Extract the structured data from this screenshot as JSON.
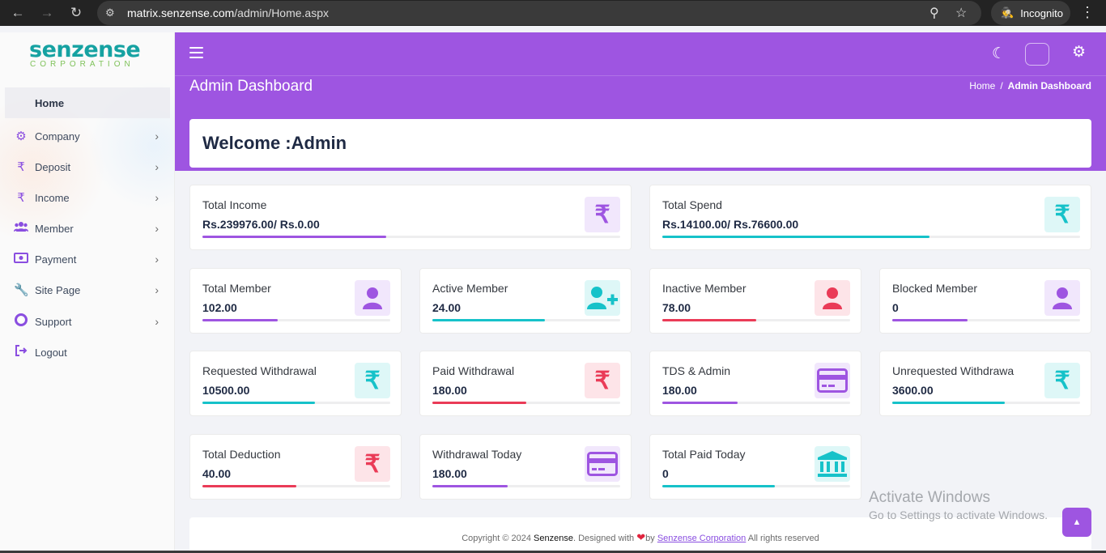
{
  "browser": {
    "url_host": "matrix.senzense.com",
    "url_path": "/admin/Home.aspx",
    "profile_label": "Incognito"
  },
  "brand": {
    "wordmark": "senzense",
    "tagline": "CORPORATION"
  },
  "sidebar": {
    "items": [
      {
        "label": "Home",
        "icon": "home-icon"
      },
      {
        "label": "Company",
        "icon": "gear-icon"
      },
      {
        "label": "Deposit",
        "icon": "rupee-icon"
      },
      {
        "label": "Income",
        "icon": "rupee-icon"
      },
      {
        "label": "Member",
        "icon": "users-icon"
      },
      {
        "label": "Payment",
        "icon": "money-icon"
      },
      {
        "label": "Site Page",
        "icon": "wrench-icon"
      },
      {
        "label": "Support",
        "icon": "lifebuoy-icon"
      },
      {
        "label": "Logout",
        "icon": "logout-icon"
      }
    ]
  },
  "header": {
    "page_title": "Admin Dashboard",
    "breadcrumb": {
      "home": "Home",
      "separator": "/",
      "current": "Admin Dashboard"
    },
    "welcome": "Welcome :Admin"
  },
  "cards": [
    {
      "title": "Total Income",
      "value": "Rs.239976.00/ Rs.0.00",
      "icon": "rupee-icon",
      "progress": 0.44,
      "color": "#9e55e1"
    },
    {
      "title": "Total Spend",
      "value": "Rs.14100.00/ Rs.76600.00",
      "icon": "rupee-icon",
      "progress": 0.64,
      "color": "#16c2c9"
    },
    {
      "title": "Total Member",
      "value": "102.00",
      "icon": "user-icon",
      "progress": 0.4,
      "color": "#9e55e1"
    },
    {
      "title": "Active Member",
      "value": "24.00",
      "icon": "user-plus-icon",
      "progress": 0.6,
      "color": "#16c2c9"
    },
    {
      "title": "Inactive Member",
      "value": "78.00",
      "icon": "user-icon",
      "progress": 0.5,
      "color": "#ea3b57"
    },
    {
      "title": "Blocked Member",
      "value": "0",
      "icon": "user-icon",
      "progress": 0.4,
      "color": "#9e55e1"
    },
    {
      "title": "Requested Withdrawal",
      "value": "10500.00",
      "icon": "rupee-icon",
      "progress": 0.6,
      "color": "#16c2c9"
    },
    {
      "title": "Paid Withdrawal",
      "value": "180.00",
      "icon": "rupee-icon",
      "progress": 0.5,
      "color": "#ea3b57"
    },
    {
      "title": "TDS & Admin",
      "value": "180.00",
      "icon": "card-icon",
      "progress": 0.4,
      "color": "#9e55e1"
    },
    {
      "title": "Unrequested Withdrawa",
      "value": "3600.00",
      "icon": "rupee-icon",
      "progress": 0.6,
      "color": "#16c2c9"
    },
    {
      "title": "Total Deduction",
      "value": "40.00",
      "icon": "rupee-icon",
      "progress": 0.5,
      "color": "#ea3b57"
    },
    {
      "title": "Withdrawal Today",
      "value": "180.00",
      "icon": "card-icon",
      "progress": 0.4,
      "color": "#9e55e1"
    },
    {
      "title": "Total Paid Today",
      "value": "0",
      "icon": "bank-icon",
      "progress": 0.6,
      "color": "#16c2c9"
    }
  ],
  "footer": {
    "copyright": "Copyright © 2024",
    "brand": "Senzense",
    "designed": ". Designed with",
    "by": "by",
    "link": "Senzense Corporation",
    "rights": "All rights reserved"
  },
  "watermark": {
    "line1": "Activate Windows",
    "line2": "Go to Settings to activate Windows."
  }
}
